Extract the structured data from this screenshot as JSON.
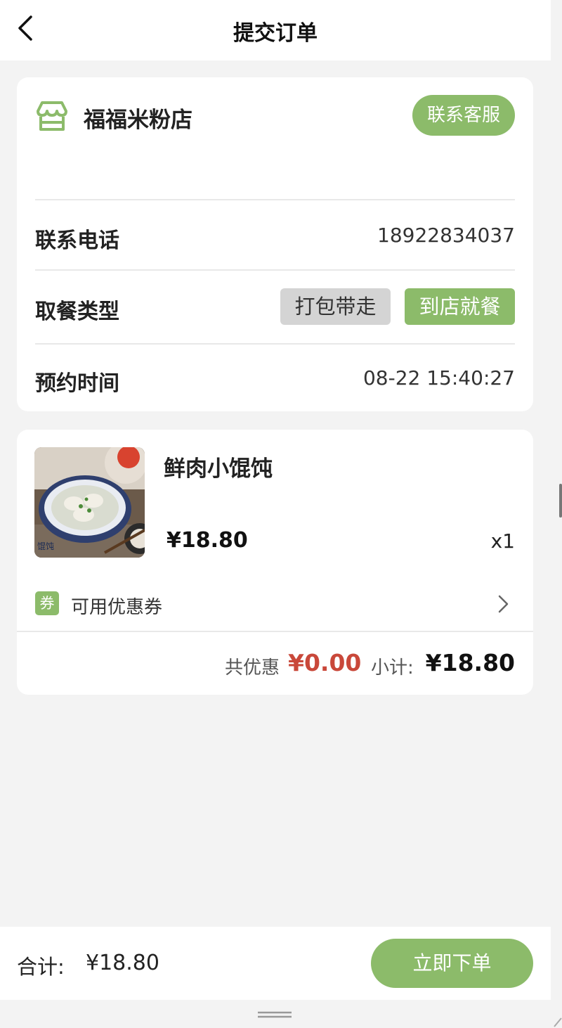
{
  "header": {
    "title": "提交订单",
    "back_icon": "chevron-left-icon"
  },
  "shop": {
    "name": "福福米粉店",
    "icon": "storefront-icon",
    "contact_button": "联系客服"
  },
  "info": {
    "phone_label": "联系电话",
    "phone_value": "18922834037",
    "pickup_label": "取餐类型",
    "pickup_options": [
      "打包带走",
      "到店就餐"
    ],
    "pickup_selected": "到店就餐",
    "time_label": "预约时间",
    "time_value": "08-22 15:40:27"
  },
  "item": {
    "name": "鲜肉小馄饨",
    "price": "¥18.80",
    "quantity": "x1",
    "image": "wonton-soup-photo",
    "image_text": "馄饨"
  },
  "coupon": {
    "tag": "券",
    "label": "可用优惠券"
  },
  "summary": {
    "discount_label": "共优惠",
    "discount_value": "¥0.00",
    "subtotal_label": "小计:",
    "subtotal_value": "¥18.80"
  },
  "footer": {
    "total_label": "合计:",
    "total_value": "¥18.80",
    "submit_button": "立即下单"
  },
  "colors": {
    "accent": "#8cbb6a",
    "discount": "#c9483a",
    "background": "#f3f3f3"
  }
}
